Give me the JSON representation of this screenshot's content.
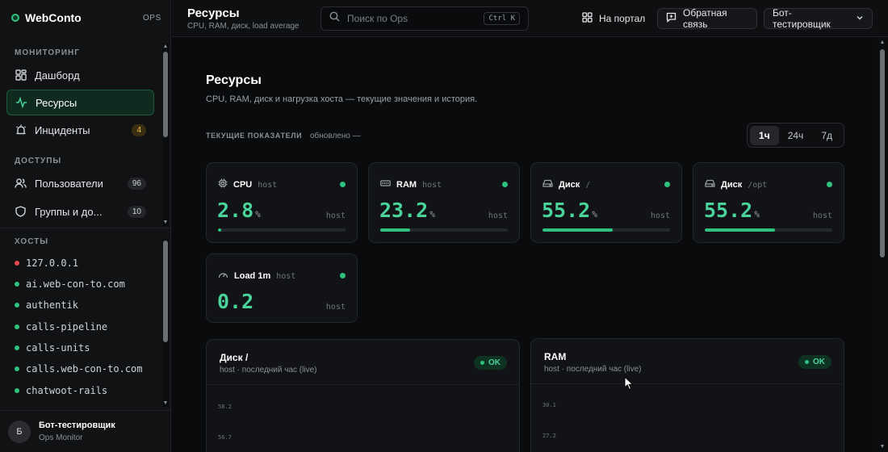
{
  "brand": {
    "name": "WebConto",
    "tag": "OPS"
  },
  "sidebar": {
    "sections": {
      "monitoring": "МОНИТОРИНГ",
      "access": "ДОСТУПЫ",
      "hosts": "ХОСТЫ"
    },
    "nav": [
      {
        "label": "Дашборд",
        "icon": "dashboard-icon"
      },
      {
        "label": "Ресурсы",
        "icon": "activity-icon",
        "active": true
      },
      {
        "label": "Инциденты",
        "icon": "siren-icon",
        "badge": "4"
      },
      {
        "label": "Пользователи",
        "icon": "users-icon",
        "badge": "96"
      },
      {
        "label": "Группы и до...",
        "icon": "shield-icon",
        "badge": "10"
      }
    ],
    "hosts": [
      {
        "name": "127.0.0.1",
        "status": "down"
      },
      {
        "name": "ai.web-con-to.com",
        "status": "up"
      },
      {
        "name": "authentik",
        "status": "up"
      },
      {
        "name": "calls-pipeline",
        "status": "up"
      },
      {
        "name": "calls-units",
        "status": "up"
      },
      {
        "name": "calls.web-con-to.com",
        "status": "up"
      },
      {
        "name": "chatwoot-rails",
        "status": "up"
      }
    ],
    "user": {
      "initial": "Б",
      "name": "Бот-тестировщик",
      "role": "Ops Monitor"
    }
  },
  "topbar": {
    "title": "Ресурсы",
    "subtitle": "CPU, RAM, диск, load average",
    "search_placeholder": "Поиск по Ops",
    "search_shortcut": "Ctrl K",
    "portal_label": "На портал",
    "feedback_label": "Обратная связь",
    "account_label": "Бот-тестировщик"
  },
  "page": {
    "title": "Ресурсы",
    "description": "CPU, RAM, диск и нагрузка хоста — текущие значения и история.",
    "current_label": "ТЕКУЩИЕ ПОКАЗАТЕЛИ",
    "updated_label": "обновлено —",
    "ranges": [
      "1ч",
      "24ч",
      "7д"
    ],
    "active_range": "1ч"
  },
  "metrics": [
    {
      "title": "CPU",
      "sub": "host",
      "value": "2.8",
      "unit": "%",
      "host": "host",
      "fill": 0.028,
      "icon": "cpu-icon"
    },
    {
      "title": "RAM",
      "sub": "host",
      "value": "23.2",
      "unit": "%",
      "host": "host",
      "fill": 0.232,
      "icon": "memory-icon"
    },
    {
      "title": "Диск",
      "sub": "/",
      "value": "55.2",
      "unit": "%",
      "host": "host",
      "fill": 0.552,
      "icon": "disk-icon"
    },
    {
      "title": "Диск",
      "sub": "/opt",
      "value": "55.2",
      "unit": "%",
      "host": "host",
      "fill": 0.552,
      "icon": "disk-icon"
    },
    {
      "title": "Load 1m",
      "sub": "host",
      "value": "0.2",
      "unit": "",
      "host": "host",
      "fill": null,
      "icon": "gauge-icon"
    }
  ],
  "panels": [
    {
      "title": "Диск /",
      "sub": "host · последний час (live)",
      "status": "OK",
      "yticks": [
        "58.2",
        "56.7"
      ]
    },
    {
      "title": "RAM",
      "sub": "host · последний час (live)",
      "status": "OK",
      "yticks": [
        "30.1",
        "27.2"
      ]
    }
  ],
  "colors": {
    "accent": "#2ec27e",
    "value": "#4ad39a",
    "bg": "#0a0b0d",
    "warn": "#f2c14e",
    "down": "#e5484d"
  }
}
